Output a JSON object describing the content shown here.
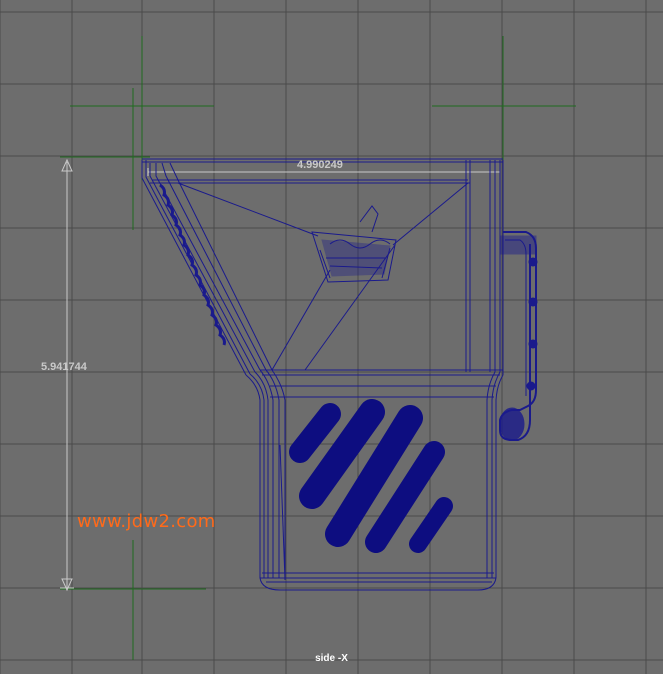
{
  "viewport": {
    "view_label": "side -X",
    "background_color": "#6d6d6d",
    "grid_color": "#4a4a4a",
    "axis_color": "#1f6b1f",
    "wire_color": "#1a1a8c",
    "fill_color": "#0d0d80"
  },
  "dimensions": {
    "width_value": "4.990249",
    "height_value": "5.941744"
  },
  "watermark": {
    "text": "www.jdw2.com",
    "color": "#ff6a1a"
  }
}
